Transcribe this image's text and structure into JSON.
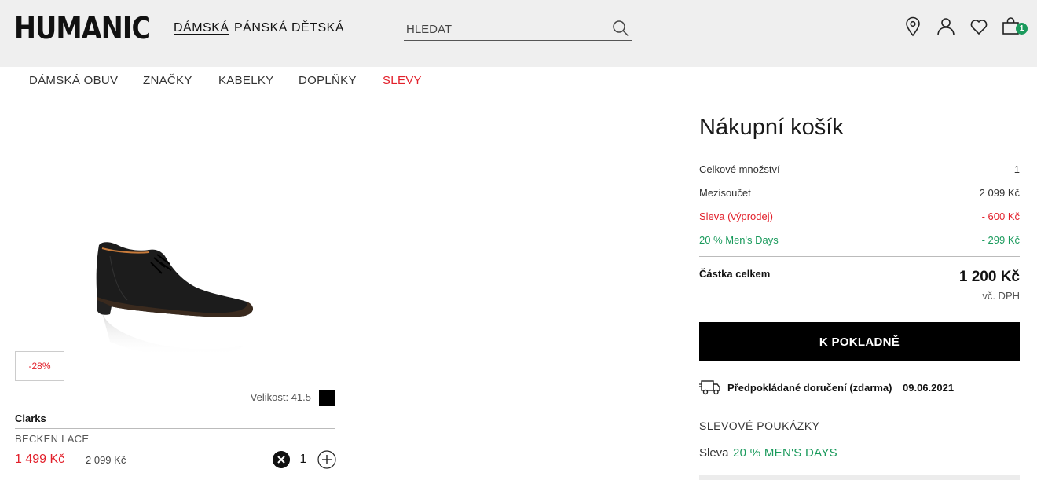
{
  "header": {
    "logo": "HUMANIC",
    "nav": [
      {
        "label": "DÁMSKÁ",
        "active": true
      },
      {
        "label": "PÁNSKÁ",
        "active": false
      },
      {
        "label": "DĚTSKÁ",
        "active": false
      }
    ],
    "search_placeholder": "HLEDAT",
    "cart_count": "1",
    "icons": [
      "location-pin-icon",
      "user-icon",
      "heart-icon",
      "shopping-bag-icon"
    ]
  },
  "category_nav": [
    {
      "label": "DÁMSKÁ OBUV"
    },
    {
      "label": "ZNAČKY"
    },
    {
      "label": "KABELKY"
    },
    {
      "label": "DOPLŇKY"
    },
    {
      "label": "SLEVY",
      "highlight": true
    }
  ],
  "product": {
    "discount_badge": "-28%",
    "size_label": "Velikost: 41.5",
    "color": "#000000",
    "brand": "Clarks",
    "model": "BECKEN LACE",
    "price": "1 499 Kč",
    "old_price": "2 099 Kč",
    "quantity": "1"
  },
  "summary": {
    "title": "Nákupní košík",
    "rows": [
      {
        "label": "Celkové množství",
        "value": "1",
        "tone": "normal"
      },
      {
        "label": "Mezisoučet",
        "value": "2 099 Kč",
        "tone": "normal"
      },
      {
        "label": "Sleva (výprodej)",
        "value": "- 600 Kč",
        "tone": "red"
      },
      {
        "label": "20 % Men's Days",
        "value": "- 299 Kč",
        "tone": "green"
      }
    ],
    "total_label": "Částka celkem",
    "total_value": "1 200 Kč",
    "vat_note": "vč. DPH",
    "checkout_label": "K POKLADNĚ",
    "delivery_label": "Předpokládané doručení (zdarma)",
    "delivery_date": "09.06.2021",
    "vouchers_title": "SLEVOVÉ POUKÁZKY",
    "voucher_prefix": "Sleva",
    "voucher_name": "20 % MEN'S DAYS"
  },
  "colors": {
    "sale_red": "#e2202b",
    "promo_green": "#1a9a5c",
    "header_bg": "#efefef"
  }
}
